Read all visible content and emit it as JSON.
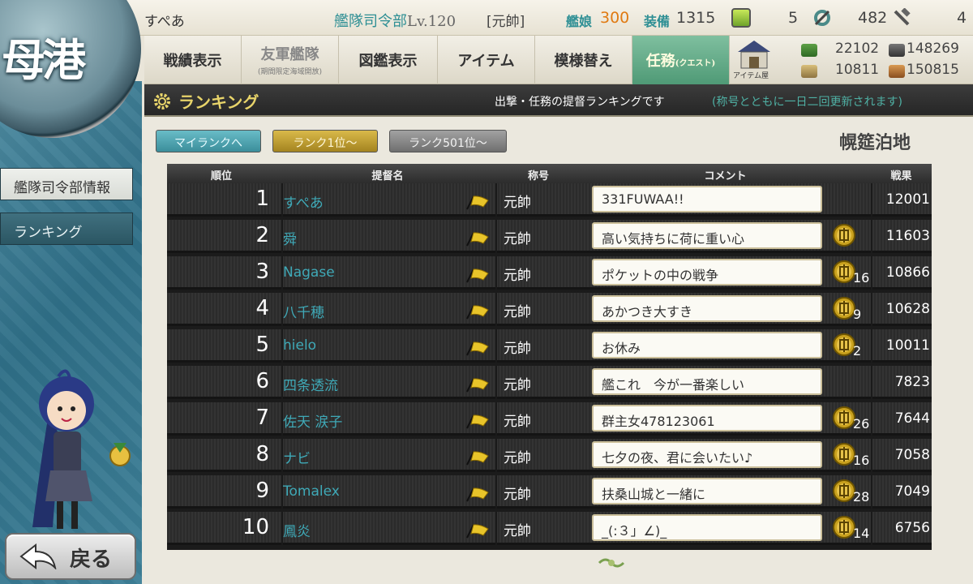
{
  "top": {
    "player_name": "すぺあ",
    "hq_label": "艦隊司令部",
    "lv_label": "Lv.",
    "level": "120",
    "rank": "[元帥]",
    "ships_label": "艦娘",
    "ships": "300",
    "equip_label": "装備",
    "equip": "1315",
    "bucket": "5",
    "dev_material": "482",
    "screw": "4"
  },
  "home": {
    "label": "母港"
  },
  "menu": {
    "items": [
      {
        "label": "戦績表示"
      },
      {
        "label": "友軍艦隊",
        "sub": "(期間限定海域開放)"
      },
      {
        "label": "図鑑表示"
      },
      {
        "label": "アイテム"
      },
      {
        "label": "模様替え"
      },
      {
        "label": "任務",
        "tag": "(クエスト)"
      }
    ],
    "shop_label": "アイテム屋"
  },
  "resources": {
    "fuel": "22102",
    "ammo": "148269",
    "steel": "10811",
    "bauxite": "150815"
  },
  "section": {
    "title": "ランキング",
    "desc": "出撃・任務の提督ランキングです",
    "note": "(称号とともに一日二回更新されます)"
  },
  "sidebar": {
    "info": "艦隊司令部情報",
    "ranking": "ランキング",
    "back": "戻る"
  },
  "tabs": {
    "my_rank": "マイランクへ",
    "rank_1": "ランク1位～",
    "rank_501": "ランク501位～"
  },
  "base_name": "幌筵泊地",
  "table": {
    "headers": {
      "rank": "順位",
      "name": "提督名",
      "title": "称号",
      "comment": "コメント",
      "score": "戦果"
    },
    "rows": [
      {
        "rank": "1",
        "name": "すぺあ",
        "title": "元帥",
        "comment": "331FUWAA!!",
        "medal": false,
        "medal_count": "",
        "score": "12001"
      },
      {
        "rank": "2",
        "name": "舜",
        "title": "元帥",
        "comment": "高い気持ちに荷に重い心",
        "medal": true,
        "medal_count": "",
        "score": "11603"
      },
      {
        "rank": "3",
        "name": "Nagase",
        "title": "元帥",
        "comment": "ポケットの中の戦争",
        "medal": true,
        "medal_count": "16",
        "score": "10866"
      },
      {
        "rank": "4",
        "name": "八千穂",
        "title": "元帥",
        "comment": "あかつき大すき",
        "medal": true,
        "medal_count": "9",
        "score": "10628"
      },
      {
        "rank": "5",
        "name": "hielo",
        "title": "元帥",
        "comment": "お休み",
        "medal": true,
        "medal_count": "2",
        "score": "10011"
      },
      {
        "rank": "6",
        "name": "四条透流",
        "title": "元帥",
        "comment": "艦これ　今が一番楽しい",
        "medal": false,
        "medal_count": "",
        "score": "7823"
      },
      {
        "rank": "7",
        "name": "佐天 涙子",
        "title": "元帥",
        "comment": "群主女478123061",
        "medal": true,
        "medal_count": "26",
        "score": "7644"
      },
      {
        "rank": "8",
        "name": "ナビ",
        "title": "元帥",
        "comment": "七夕の夜、君に会いたい♪",
        "medal": true,
        "medal_count": "16",
        "score": "7058"
      },
      {
        "rank": "9",
        "name": "Tomalex",
        "title": "元帥",
        "comment": "扶桑山城と一緒に",
        "medal": true,
        "medal_count": "28",
        "score": "7049"
      },
      {
        "rank": "10",
        "name": "鳳炎",
        "title": "元帥",
        "comment": "_(:３」∠)_",
        "medal": true,
        "medal_count": "14",
        "score": "6756"
      }
    ]
  },
  "colors": {
    "accent_teal": "#2e8f94",
    "header_gold": "#e8d46a",
    "name_teal": "#3fa9b7",
    "ships_orange": "#e07a12"
  }
}
